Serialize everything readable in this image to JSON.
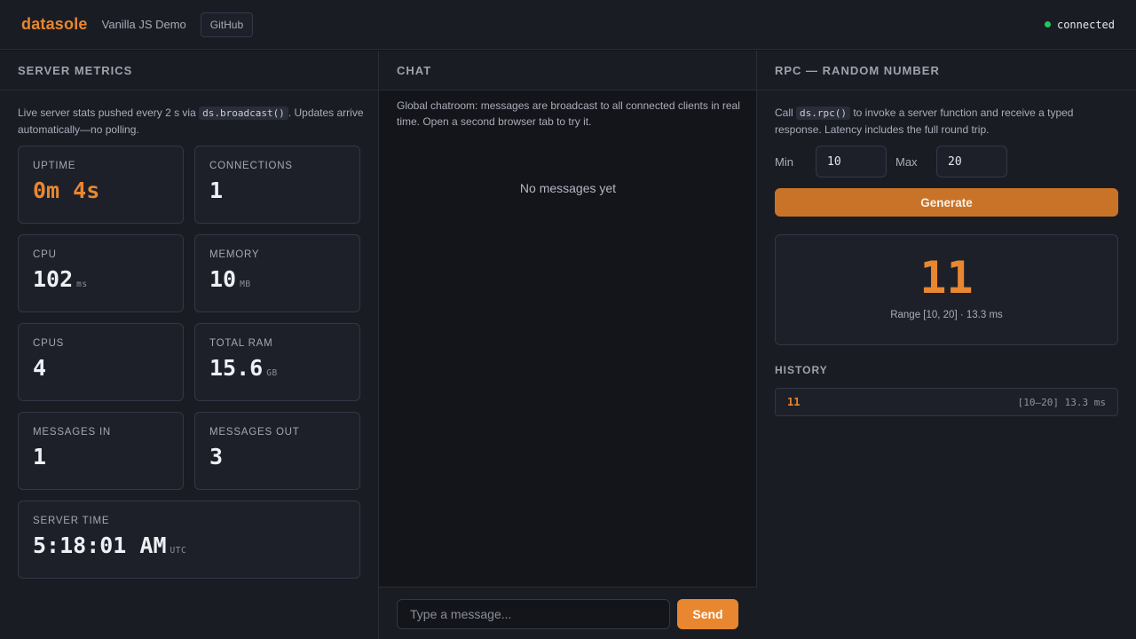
{
  "header": {
    "brand": "datasole",
    "subtitle": "Vanilla JS Demo",
    "github_label": "GitHub",
    "status_text": "connected",
    "status_color": "#22c55e"
  },
  "theme": {
    "accent": "#e8872f",
    "background": "#13151b",
    "panel": "#1a1c24"
  },
  "metrics": {
    "title": "SERVER METRICS",
    "desc_before": "Live server stats pushed every 2 s via ",
    "desc_code": "ds.broadcast()",
    "desc_after": ". Updates arrive automatically—no polling.",
    "uptime": {
      "label": "UPTIME",
      "value": "0m 4s"
    },
    "connections": {
      "label": "CONNECTIONS",
      "value": "1"
    },
    "cpu": {
      "label": "CPU",
      "value": "102",
      "unit": "ms"
    },
    "memory": {
      "label": "MEMORY",
      "value": "10",
      "unit": "MB"
    },
    "cpus": {
      "label": "CPUS",
      "value": "4"
    },
    "total_ram": {
      "label": "TOTAL RAM",
      "value": "15.6",
      "unit": "GB"
    },
    "messages_in": {
      "label": "MESSAGES IN",
      "value": "1"
    },
    "messages_out": {
      "label": "MESSAGES OUT",
      "value": "3"
    },
    "server_time": {
      "label": "SERVER TIME",
      "value": "5:18:01 AM",
      "unit": "UTC"
    }
  },
  "chat": {
    "title": "CHAT",
    "desc": "Global chatroom: messages are broadcast to all connected clients in real time. Open a second browser tab to try it.",
    "empty": "No messages yet",
    "input_placeholder": "Type a message...",
    "send_label": "Send"
  },
  "rpc": {
    "title": "RPC — RANDOM NUMBER",
    "desc_before": "Call ",
    "desc_code": "ds.rpc()",
    "desc_after": " to invoke a server function and receive a typed response. Latency includes the full round trip.",
    "min_label": "Min",
    "min_value": "10",
    "max_label": "Max",
    "max_value": "20",
    "generate_label": "Generate",
    "result": "11",
    "result_meta": "Range [10, 20] · 13.3 ms",
    "history_title": "HISTORY",
    "history": [
      {
        "value": "11",
        "meta": "[10–20] 13.3 ms"
      }
    ]
  }
}
